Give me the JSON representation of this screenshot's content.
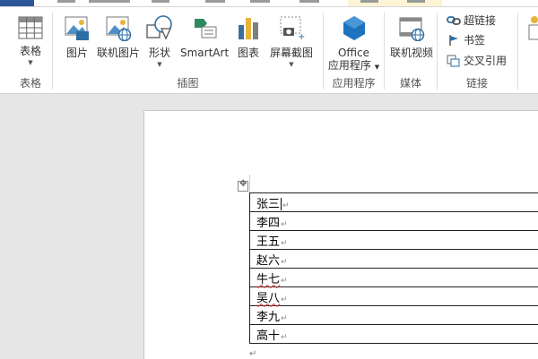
{
  "ribbon": {
    "groups": {
      "tables": {
        "label": "表格",
        "table_button": "表格"
      },
      "illustrations": {
        "label": "插图",
        "picture": "图片",
        "online_picture": "联机图片",
        "shapes": "形状",
        "smartart": "SmartArt",
        "chart": "图表",
        "screenshot": "屏幕截图"
      },
      "apps": {
        "label": "应用程序",
        "office_line1": "Office",
        "office_line2": "应用程序"
      },
      "media": {
        "label": "媒体",
        "online_video": "联机视频"
      },
      "links": {
        "label": "链接",
        "hyperlink": "超链接",
        "bookmark": "书签",
        "cross_reference": "交叉引用"
      }
    }
  },
  "document": {
    "table_rows": [
      "张三",
      "李四",
      "王五",
      "赵六",
      "牛七",
      "吴八",
      "李九",
      "高十"
    ],
    "paragraph_mark": "↵"
  },
  "colors": {
    "accent": "#2b579a",
    "office_icon": "#1e73be",
    "chart_bar": "#3c6e9f",
    "border": "#222222"
  }
}
